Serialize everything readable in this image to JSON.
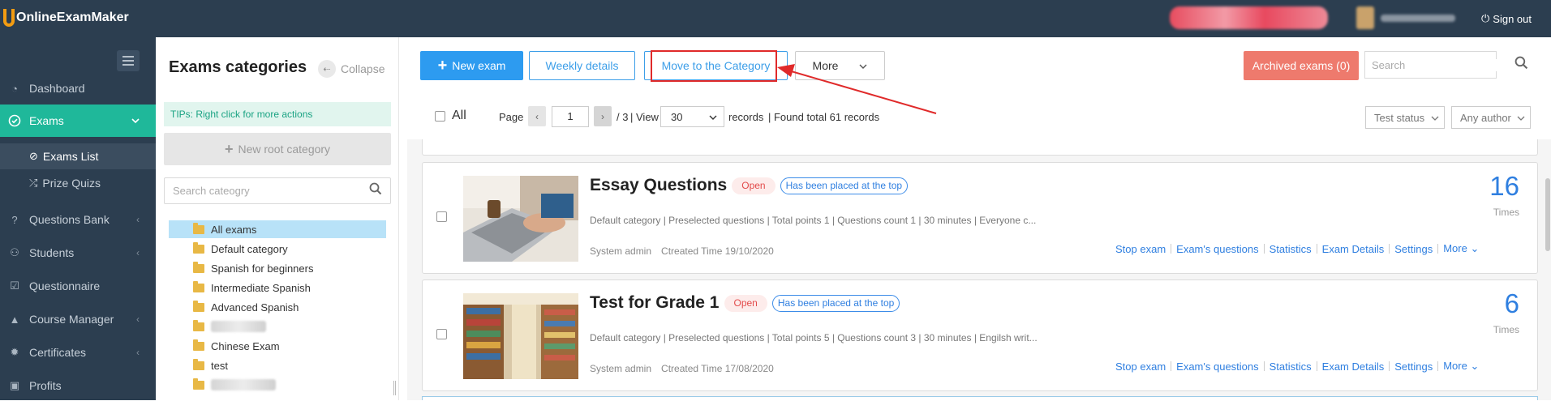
{
  "app": {
    "logo_text": "OnlineExamMaker",
    "signout_label": "Sign out"
  },
  "sidebar": {
    "items": [
      {
        "label": "Dashboard",
        "icon": "dashboard-icon"
      },
      {
        "label": "Exams",
        "icon": "check-circle-icon",
        "active": true
      },
      {
        "label": "Questions Bank",
        "icon": "question-icon"
      },
      {
        "label": "Students",
        "icon": "user-icon"
      },
      {
        "label": "Questionnaire",
        "icon": "checkbox-icon"
      },
      {
        "label": "Course Manager",
        "icon": "graduation-cap-icon"
      },
      {
        "label": "Certificates",
        "icon": "gear-icon"
      },
      {
        "label": "Profits",
        "icon": "wallet-icon"
      }
    ],
    "subitems": [
      {
        "label": "Exams List",
        "active": true
      },
      {
        "label": "Prize Quizs"
      }
    ]
  },
  "categories": {
    "title": "Exams categories",
    "collapse_label": "Collapse",
    "tips": "TIPs: Right click for more actions",
    "new_root_label": "New root category",
    "search_placeholder": "Search cateogry",
    "tree": [
      "All exams",
      "Default category",
      "Spanish for beginners",
      "Intermediate Spanish",
      "Advanced Spanish",
      "",
      "Chinese Exam",
      "test",
      ""
    ]
  },
  "toolbar": {
    "new_exam": "New exam",
    "weekly_details": "Weekly details",
    "move_to_category": "Move to the Category",
    "more": "More",
    "archived": "Archived exams (0)",
    "search_placeholder": "Search"
  },
  "pager": {
    "all_label": "All",
    "page_label": "Page",
    "page_value": "1",
    "total_pages": "/ 3",
    "view_label": "| View",
    "view_value": "30",
    "records_label": "records",
    "found_label": "| Found total 61 records",
    "test_status": "Test status",
    "any_author": "Any author"
  },
  "exams": [
    {
      "title": "Essay Questions",
      "status": "Open",
      "pinned": "Has been placed at the top",
      "meta": "Default category | Preselected questions | Total points 1 | Questions count 1 | 30 minutes | Everyone c...",
      "author": "System admin",
      "created": "Ctreated Time 19/10/2020",
      "count": "16",
      "times": "Times",
      "actions": [
        "Stop exam",
        "Exam's questions",
        "Statistics",
        "Exam Details",
        "Settings",
        "More"
      ]
    },
    {
      "title": "Test for Grade 1",
      "status": "Open",
      "pinned": "Has been placed at the top",
      "meta": "Default category | Preselected questions | Total points 5 | Questions count 3 | 30 minutes | Engilsh writ...",
      "author": "System admin",
      "created": "Ctreated Time 17/08/2020",
      "count": "6",
      "times": "Times",
      "actions": [
        "Stop exam",
        "Exam's questions",
        "Statistics",
        "Exam Details",
        "Settings",
        "More"
      ]
    }
  ],
  "colors": {
    "topbar": "#2c3e50",
    "accent": "#1fb89a",
    "primary": "#2d9bf0",
    "archive": "#ee7a6d",
    "highlight": "#e02a2a"
  }
}
